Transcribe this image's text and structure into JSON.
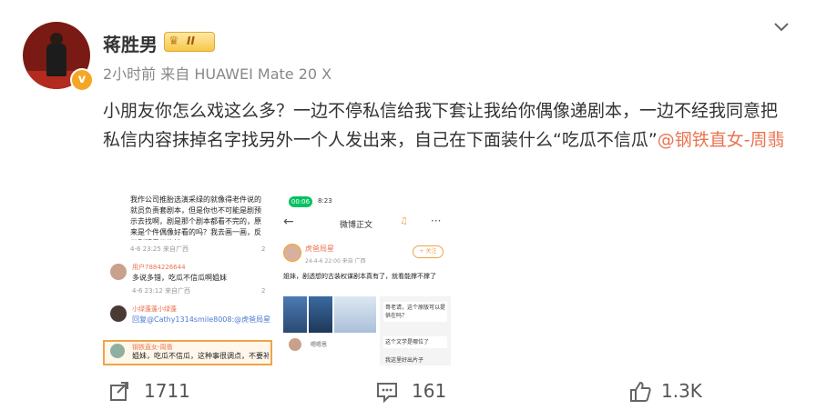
{
  "post": {
    "author": "蒋胜男",
    "level": "II",
    "verified_mark": "v",
    "meta": "2小时前  来自 HUAWEI Mate 20 X",
    "body_text": "小朋友你怎么戏这么多？一边不停私信给我下套让我给你偶像递剧本，一边不经我同意把私信内容抹掉名字找另外一个人发出来，自己在下面装什么“吃瓜不信瓜”",
    "mention": "@钢铁直女-周翡"
  },
  "image_left": {
    "top_text": "我作公司推胎选演采绿的就像得老件说的就员负责套剧本，但是你也不可能是剧预示去找啊，剧是那个剧本都看不完的，原来是个件偶像好看的吗？我去画一画，反正剧版是不许地",
    "top_time": "4-6 23:25  来自广西",
    "top_count": "2",
    "c1_name": "用户7884226644",
    "c1_text": "多说多错，吃瓜不信瓜啊姐妹",
    "c1_time": "4-6 23:12  来自广西",
    "c1_count": "2",
    "c2_name": "小绿蓬蓬小绿蓬",
    "c2_text": "回复@Cathy1314smile8008:@虎爸局星",
    "c3_name": "钢铁直女-周翡",
    "c3_text": "姐妹，吃瓜不信瓜，这种事很调点，不要补上一后补",
    "c3_text2": "是我，不要然见"
  },
  "image_right": {
    "status_time": "00:06",
    "status_clock": "8:23",
    "header_title": "微博正文",
    "user": "虎爸局星",
    "user_time": "24-4-6 22:00  来自 广西",
    "follow": "+ 关注",
    "post_text": "姐妹，剧透想的古装权谋剧本真有了，就看能撑不撑了",
    "chat_name": "嗯嗯恩",
    "chat_text1": "哥老请，这个原版可以提供在吗？",
    "chat_text2": "这个文学是哪位了",
    "chat_text3": "我这里好出片子"
  },
  "actions": {
    "repost_count": "1711",
    "comment_count": "161",
    "like_count": "1.3K"
  },
  "colors": {
    "mention": "#eb7350",
    "meta": "#888888",
    "level_gold": "#f6c84a",
    "verified": "#f5a623",
    "status_green": "#07c160"
  },
  "icons": [
    "chevron-down-icon",
    "repost-icon",
    "comment-icon",
    "like-icon",
    "crown-icon"
  ]
}
